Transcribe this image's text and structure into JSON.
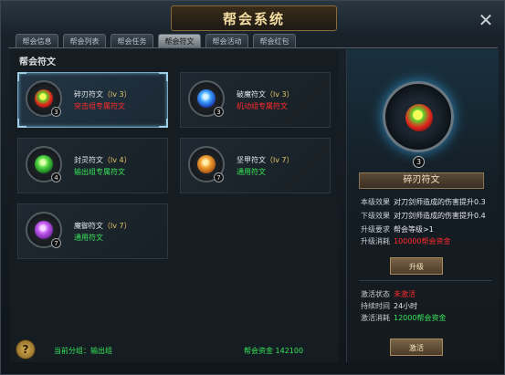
{
  "window": {
    "title": "帮会系统"
  },
  "tabs": [
    {
      "label": "帮会信息"
    },
    {
      "label": "帮会列表"
    },
    {
      "label": "帮会任务"
    },
    {
      "label": "帮会符文"
    },
    {
      "label": "帮会活动"
    },
    {
      "label": "帮会红包"
    }
  ],
  "active_tab": "帮会符文",
  "section_title": "帮会符文",
  "runes": [
    {
      "name": "碎刃符文",
      "level": "（lv 3）",
      "desc": "突击组专属符文",
      "desc_color": "red",
      "badge": "3",
      "icon": "flame-gem-icon"
    },
    {
      "name": "破魔符文",
      "level": "（lv 3）",
      "desc": "机动组专属符文",
      "desc_color": "red",
      "badge": "3",
      "icon": "ice-gem-icon"
    },
    {
      "name": "封灵符文",
      "level": "（lv 4）",
      "desc": "输出组专属符文",
      "desc_color": "green",
      "badge": "4",
      "icon": "jade-gem-icon"
    },
    {
      "name": "坚甲符文",
      "level": "（lv 7）",
      "desc": "通用符文",
      "desc_color": "green",
      "badge": "7",
      "icon": "amber-gem-icon"
    },
    {
      "name": "魔御符文",
      "level": "（lv 7）",
      "desc": "通用符文",
      "desc_color": "green",
      "badge": "7",
      "icon": "violet-gem-icon"
    }
  ],
  "detail": {
    "badge": "3",
    "name": "碎刃符文",
    "current_effect_label": "本级效果",
    "current_effect": "对刀剑师造成的伤害提升0.3",
    "next_effect_label": "下级效果",
    "next_effect": "对刀剑师造成的伤害提升0.4",
    "requirement_label": "升级要求",
    "requirement": "帮会等级>1",
    "cost_label": "升级消耗",
    "cost": "100000帮会资金",
    "upgrade_button": "升级",
    "activation_label": "激活状态",
    "activation": "未激活",
    "duration_label": "持续时间",
    "duration": "24小时",
    "activate_cost_label": "激活消耗",
    "activate_cost": "12000帮会资金",
    "activate_button": "激活"
  },
  "footer": {
    "group": "当前分组：输出组",
    "funds": "帮会资金 142100"
  },
  "colors": {
    "red": "#ff2a2a",
    "green": "#36e55a",
    "gold": "#e4c765"
  }
}
